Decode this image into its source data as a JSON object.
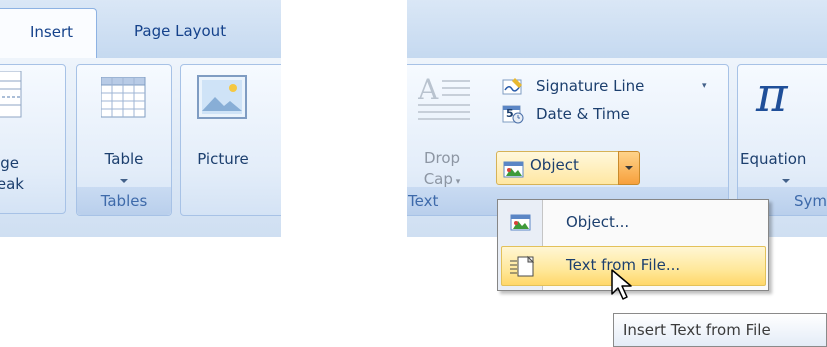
{
  "left_panel": {
    "tabs": {
      "insert": "Insert",
      "page_layout": "Page Layout"
    },
    "page_break": {
      "label_line1": "age",
      "label_line2": "reak"
    },
    "tables_group": {
      "table_label": "Table",
      "group_label": "Tables"
    },
    "picture": {
      "label": "Picture"
    }
  },
  "right_panel": {
    "drop_cap": {
      "label_line1": "Drop",
      "label_line2": "Cap"
    },
    "signature_line": {
      "label": "Signature Line"
    },
    "date_time": {
      "label": "Date & Time"
    },
    "object": {
      "label": "Object"
    },
    "text_group_label": "Text",
    "equation": {
      "label": "Equation",
      "symbol": "π"
    },
    "symbols_group_label": "Sym",
    "date_icon_text": "5"
  },
  "dropdown_menu": {
    "items": [
      {
        "label": "Object...",
        "icon": "object-icon",
        "highlighted": false
      },
      {
        "label": "Text from File...",
        "icon": "text-file-icon",
        "highlighted": true
      }
    ]
  },
  "tooltip": {
    "text": "Insert Text from File"
  },
  "colors": {
    "highlight": "#ffe89a",
    "ribbon": "#dce8f6",
    "accent_text": "#15428b"
  }
}
